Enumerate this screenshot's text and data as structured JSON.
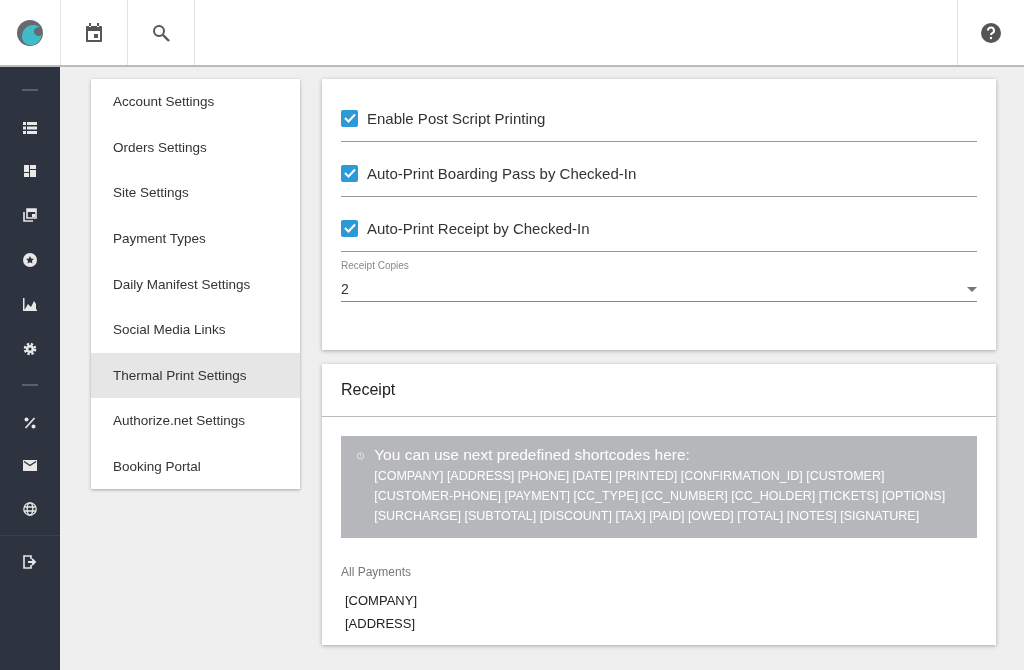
{
  "settings_menu": [
    {
      "label": "Account Settings",
      "selected": false
    },
    {
      "label": "Orders Settings",
      "selected": false
    },
    {
      "label": "Site Settings",
      "selected": false
    },
    {
      "label": "Payment Types",
      "selected": false
    },
    {
      "label": "Daily Manifest Settings",
      "selected": false
    },
    {
      "label": "Social Media Links",
      "selected": false
    },
    {
      "label": "Thermal Print Settings",
      "selected": true
    },
    {
      "label": "Authorize.net Settings",
      "selected": false
    },
    {
      "label": "Booking Portal",
      "selected": false
    }
  ],
  "print_options": [
    {
      "label": "Enable Post Script Printing",
      "checked": true
    },
    {
      "label": "Auto-Print Boarding Pass by Checked-In",
      "checked": true
    },
    {
      "label": "Auto-Print Receipt by Checked-In",
      "checked": true
    }
  ],
  "receipt_copies": {
    "label": "Receipt Copies",
    "value": "2"
  },
  "receipt": {
    "title": "Receipt",
    "info": {
      "title": "You can use next predefined shortcodes here:",
      "text": "[COMPANY] [ADDRESS] [PHONE] [DATE] [PRINTED] [CONFIRMATION_ID] [CUSTOMER] [CUSTOMER-PHONE] [PAYMENT] [CC_TYPE] [CC_NUMBER] [CC_HOLDER] [TICKETS] [OPTIONS] [SURCHARGE] [SUBTOTAL] [DISCOUNT] [TAX] [PAID] [OWED] [TOTAL] [NOTES] [SIGNATURE]"
    },
    "template": {
      "label": "All Payments",
      "lines": [
        "[COMPANY]",
        "[ADDRESS]"
      ]
    }
  }
}
